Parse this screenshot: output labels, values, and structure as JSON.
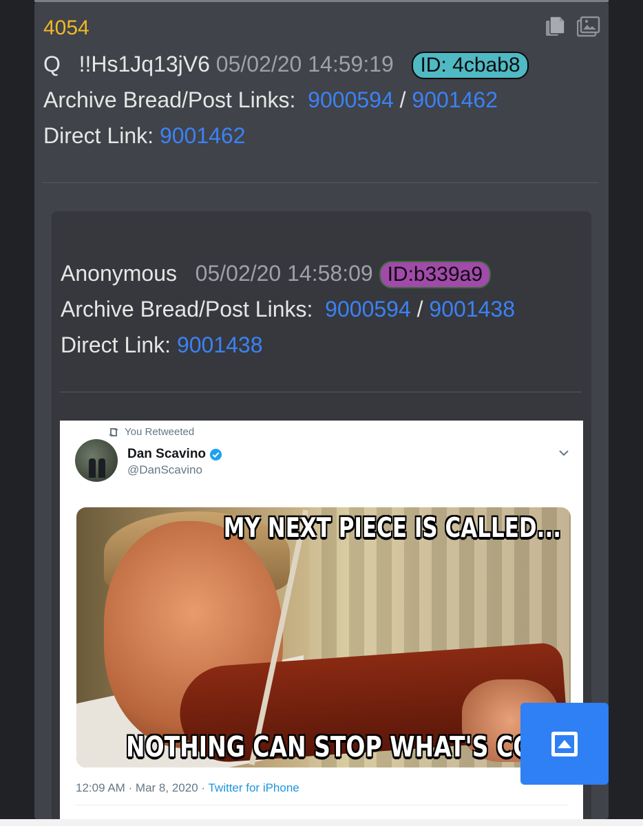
{
  "post": {
    "number": "4054",
    "author": "Q",
    "tripcode": "!!Hs1Jq13jV6",
    "datetime": "05/02/20 14:59:19",
    "id_badge": "ID: 4cbab8",
    "archive_label": "Archive Bread/Post Links:",
    "archive_bread": "9000594",
    "archive_post": "9001462",
    "slash": "/",
    "direct_label": "Direct Link:",
    "direct_link": "9001462",
    "icons": [
      "copy-icon",
      "images-icon"
    ]
  },
  "quoted": {
    "author": "Anonymous",
    "datetime": "05/02/20 14:58:09",
    "id_badge": "ID:b339a9",
    "archive_label": "Archive Bread/Post Links:",
    "archive_bread": "9000594",
    "archive_post": "9001438",
    "slash": "/",
    "direct_label": "Direct Link:",
    "direct_link": "9001438"
  },
  "tweet": {
    "retweet_label": "You Retweeted",
    "name": "Dan Scavino",
    "handle": "@DanScavino",
    "meme_top": "MY NEXT PIECE IS CALLED...",
    "meme_bottom": "NOTHING CAN STOP WHAT'S COMIN",
    "time": "12:09 AM · Mar 8, 2020 · ",
    "via": "Twitter for iPhone"
  },
  "colors": {
    "post_number": "#f2b928",
    "link": "#3b82f6",
    "id_q": "#4fb9c4",
    "id_anon": "#a24aab",
    "fab": "#2f7ff5"
  }
}
